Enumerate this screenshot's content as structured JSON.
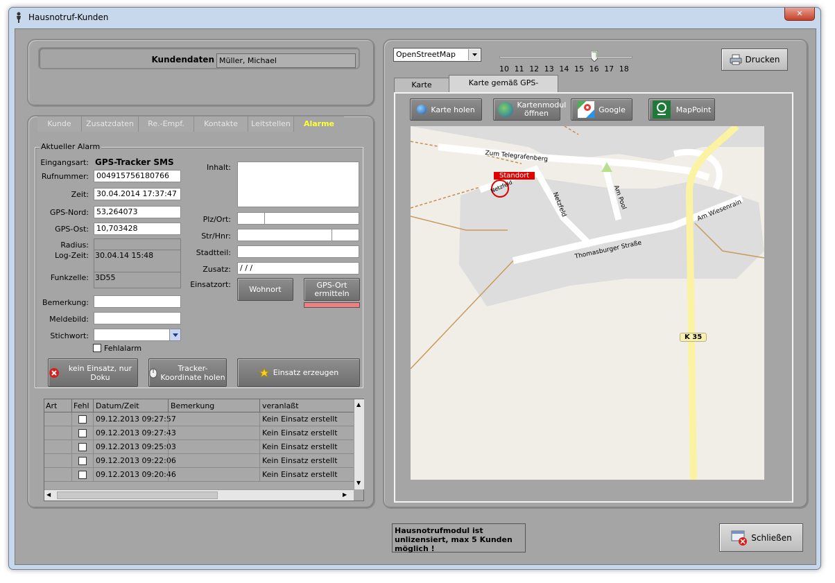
{
  "window": {
    "title": "Hausnotruf-Kunden",
    "close_glyph": "✕"
  },
  "kundendaten": {
    "label": "Kundendaten",
    "value": "Müller, Michael"
  },
  "tabs": [
    "Kunde",
    "Zusatzdaten",
    "Re.-Empf.",
    "Kontakte",
    "Leitstellen",
    "Alarme"
  ],
  "active_tab": "Alarme",
  "alarm": {
    "group_title": "Aktueller Alarm",
    "eingangsart_label": "Eingangsart:",
    "eingangsart_value": "GPS-Tracker SMS",
    "rufnummer_label": "Rufnummer:",
    "rufnummer_value": "004915756180766",
    "zeit_label": "Zeit:",
    "zeit_value": "30.04.2014 17:37:47",
    "gps_nord_label": "GPS-Nord:",
    "gps_nord_value": "53,264073",
    "gps_ost_label": "GPS-Ost:",
    "gps_ost_value": "10,703428",
    "radius_label": "Radius:",
    "logzeit_label": "Log-Zeit:",
    "logzeit_value": "30.04.14 15:48",
    "funkzelle_label": "Funkzelle:",
    "funkzelle_value": "3D55",
    "bemerkung_label": "Bemerkung:",
    "meldebild_label": "Meldebild:",
    "stichwort_label": "Stichwort:",
    "fehlalarm_label": "Fehlalarm",
    "inhalt_label": "Inhalt:",
    "plzort_label": "Plz/Ort:",
    "strhnr_label": "Str/Hnr:",
    "stadtteil_label": "Stadtteil:",
    "zusatz_label": "Zusatz:",
    "zusatz_value": " /  /  /",
    "einsatzort_label": "Einsatzort:",
    "wohnort_button": "Wohnort",
    "gps_ort_button": "GPS-Ort ermitteln",
    "kein_einsatz_button": "kein Einsatz, nur Doku",
    "tracker_button": "Tracker-Koordinate holen",
    "einsatz_button": "Einsatz erzeugen"
  },
  "grid": {
    "columns": [
      "Art",
      "Fehl",
      "Datum/Zeit",
      "Bemerkung",
      "veranlaßt"
    ],
    "rows": [
      {
        "datum": "09.12.2013 09:27:57",
        "veranlasst": "Kein Einsatz erstellt"
      },
      {
        "datum": "09.12.2013 09:27:43",
        "veranlasst": "Kein Einsatz erstellt"
      },
      {
        "datum": "09.12.2013 09:25:03",
        "veranlasst": "Kein Einsatz erstellt"
      },
      {
        "datum": "09.12.2013 09:22:06",
        "veranlasst": "Kein Einsatz erstellt"
      },
      {
        "datum": "09.12.2013 09:20:46",
        "veranlasst": "Kein Einsatz erstellt"
      }
    ]
  },
  "map": {
    "provider": "OpenStreetMap",
    "zoom_ticks": [
      "10",
      "11",
      "12",
      "13",
      "14",
      "15",
      "16",
      "17",
      "18"
    ],
    "zoom_level": 16,
    "drucken_button": "Drucken",
    "tabs": [
      "Karte Wohnort",
      "Karte gemäß GPS-Koordinaten"
    ],
    "karte_holen": "Karte holen",
    "kartenmodul": "Kartenmodul öffnen",
    "google": "Google",
    "mappoint": "MapPoint",
    "streets": {
      "telegrafenberg": "Zum Telegrafenberg",
      "thomasburger": "Thomasburger Straße",
      "wiesenrain": "Am Wiesenrain",
      "pool": "Am Pool",
      "netzfeld": "Netzfeld",
      "netz_small": "Netzfeld"
    },
    "marker_label": "Standort",
    "road_badge": "K 35"
  },
  "license_notice": "Hausnotrufmodul ist unlizensiert, max 5 Kunden möglich !",
  "schliessen_button": "Schließen",
  "colors": {
    "active_tab_text": "#ffff33",
    "marker": "#e00000",
    "gps_indicator": "#f08080"
  }
}
